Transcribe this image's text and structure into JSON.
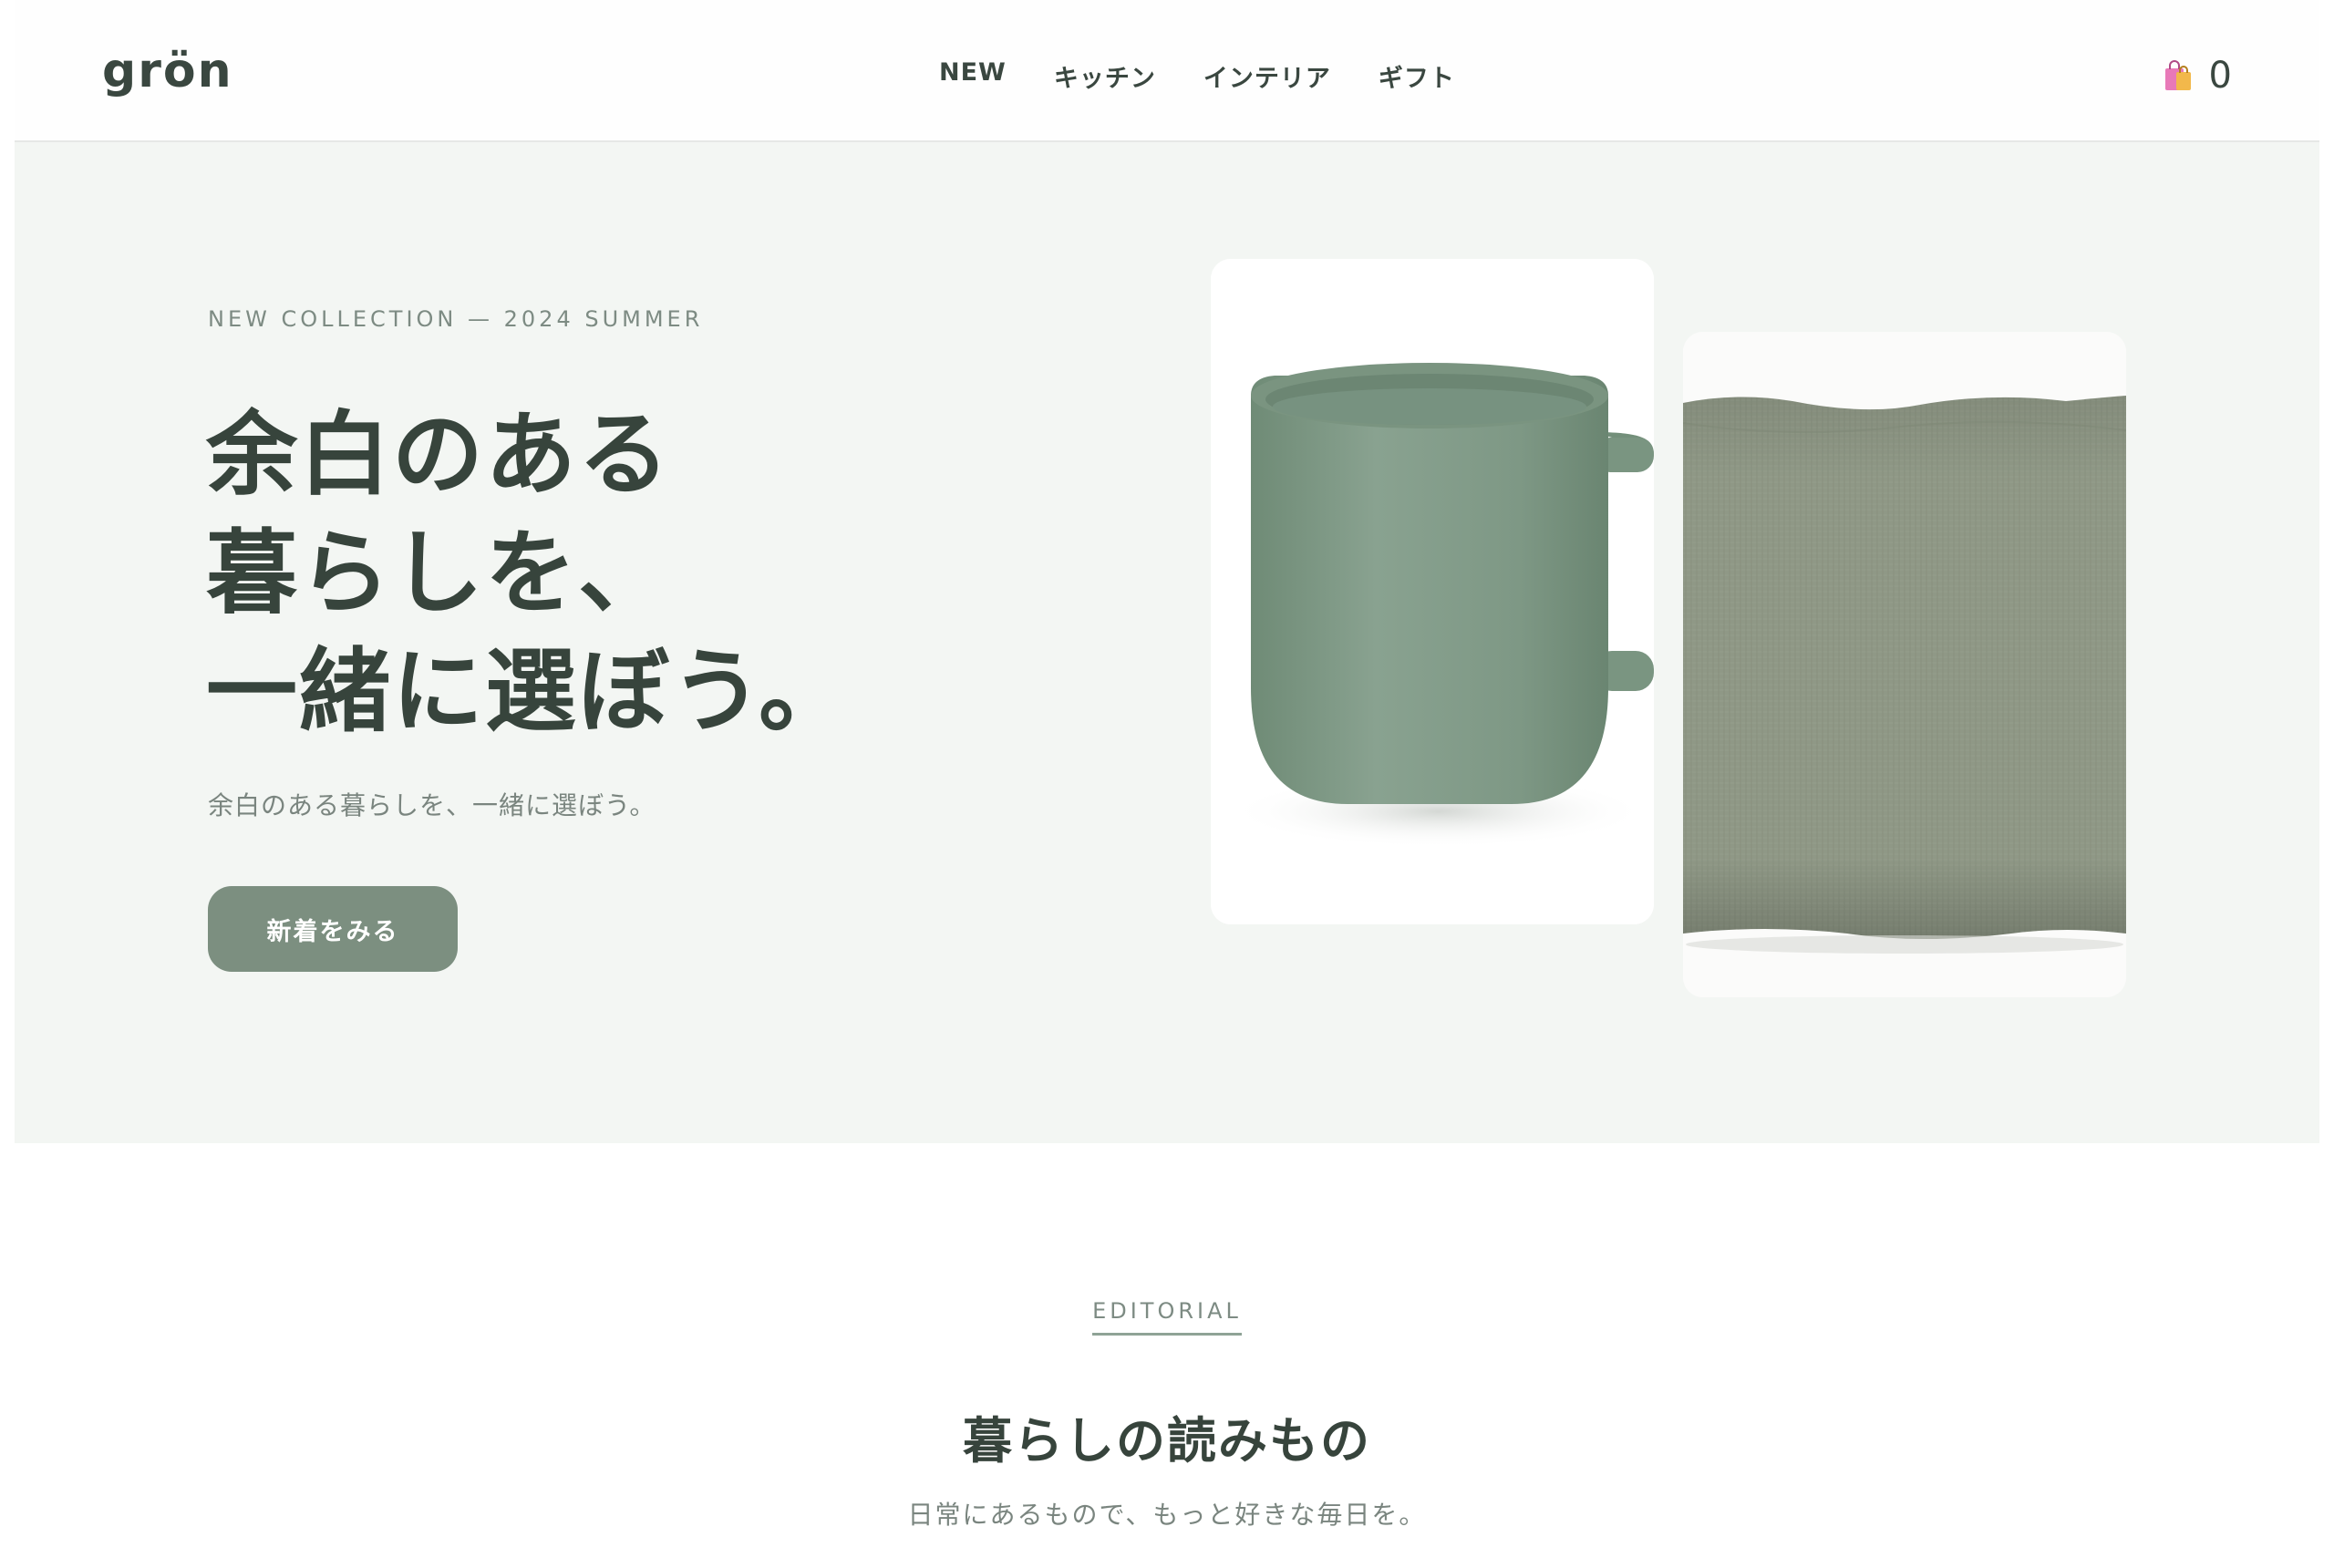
{
  "header": {
    "logo": "grön",
    "nav": [
      "NEW",
      "キッチン",
      "インテリア",
      "ギフト"
    ],
    "cart_icon": "shopping-bags-icon",
    "cart_count": "0"
  },
  "hero": {
    "eyebrow": "NEW COLLECTION — 2024 SUMMER",
    "title_lines": [
      "余白のある",
      "暮らしを、",
      "一緒に選ぼう。"
    ],
    "subtitle": "余白のある暮らしを、一緒に選ぼう。",
    "cta_label": "新着をみる",
    "products": [
      {
        "name": "green-mug",
        "color": "#7f9a86"
      },
      {
        "name": "linen-cushion",
        "color": "#8f9886"
      }
    ]
  },
  "editorial": {
    "eyebrow": "EDITORIAL",
    "title": "暮らしの読みもの",
    "subtitle": "日常にあるもので、もっと好きな毎日を。"
  },
  "colors": {
    "accent": "#7c8f80",
    "text": "#37443c",
    "hero_bg": "#f3f6f3"
  }
}
